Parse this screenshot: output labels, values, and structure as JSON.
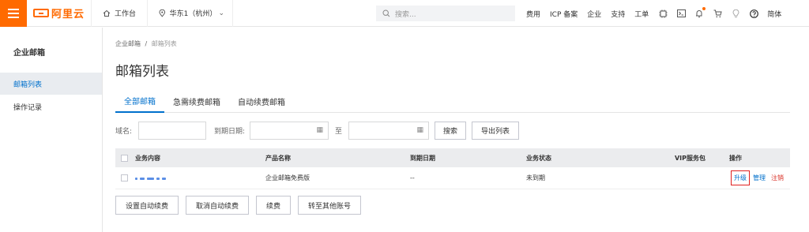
{
  "topbar": {
    "logo_text": "阿里云",
    "workbench": "工作台",
    "region": "华东1（杭州）",
    "search_placeholder": "搜索...",
    "nav": [
      "费用",
      "ICP 备案",
      "企业",
      "支持",
      "工单"
    ],
    "lang": "简体"
  },
  "sidebar": {
    "title": "企业邮箱",
    "items": [
      {
        "label": "邮箱列表",
        "active": true
      },
      {
        "label": "操作记录",
        "active": false
      }
    ]
  },
  "breadcrumb": {
    "root": "企业邮箱",
    "separator": "/",
    "current": "邮箱列表"
  },
  "page_title": "邮箱列表",
  "tabs": [
    "全部邮箱",
    "急需续费邮箱",
    "自动续费邮箱"
  ],
  "filter": {
    "domain_label": "域名:",
    "expiry_label": "到期日期:",
    "to_label": "至",
    "search_button": "搜索",
    "export_button": "导出列表"
  },
  "table": {
    "headers": [
      "业务内容",
      "产品名称",
      "到期日期",
      "业务状态",
      "VIP服务包",
      "操作"
    ],
    "rows": [
      {
        "product": "企业邮箱免费版",
        "expiry": "--",
        "status": "未到期",
        "vip": ""
      }
    ],
    "row_actions": {
      "upgrade": "升级",
      "manage": "管理",
      "cancel": "注销"
    }
  },
  "actions": [
    "设置自动续费",
    "取消自动续费",
    "续费",
    "转至其他账号"
  ],
  "colors": {
    "brand": "#ff6a00",
    "link": "#0070cc",
    "danger": "#d93026"
  }
}
